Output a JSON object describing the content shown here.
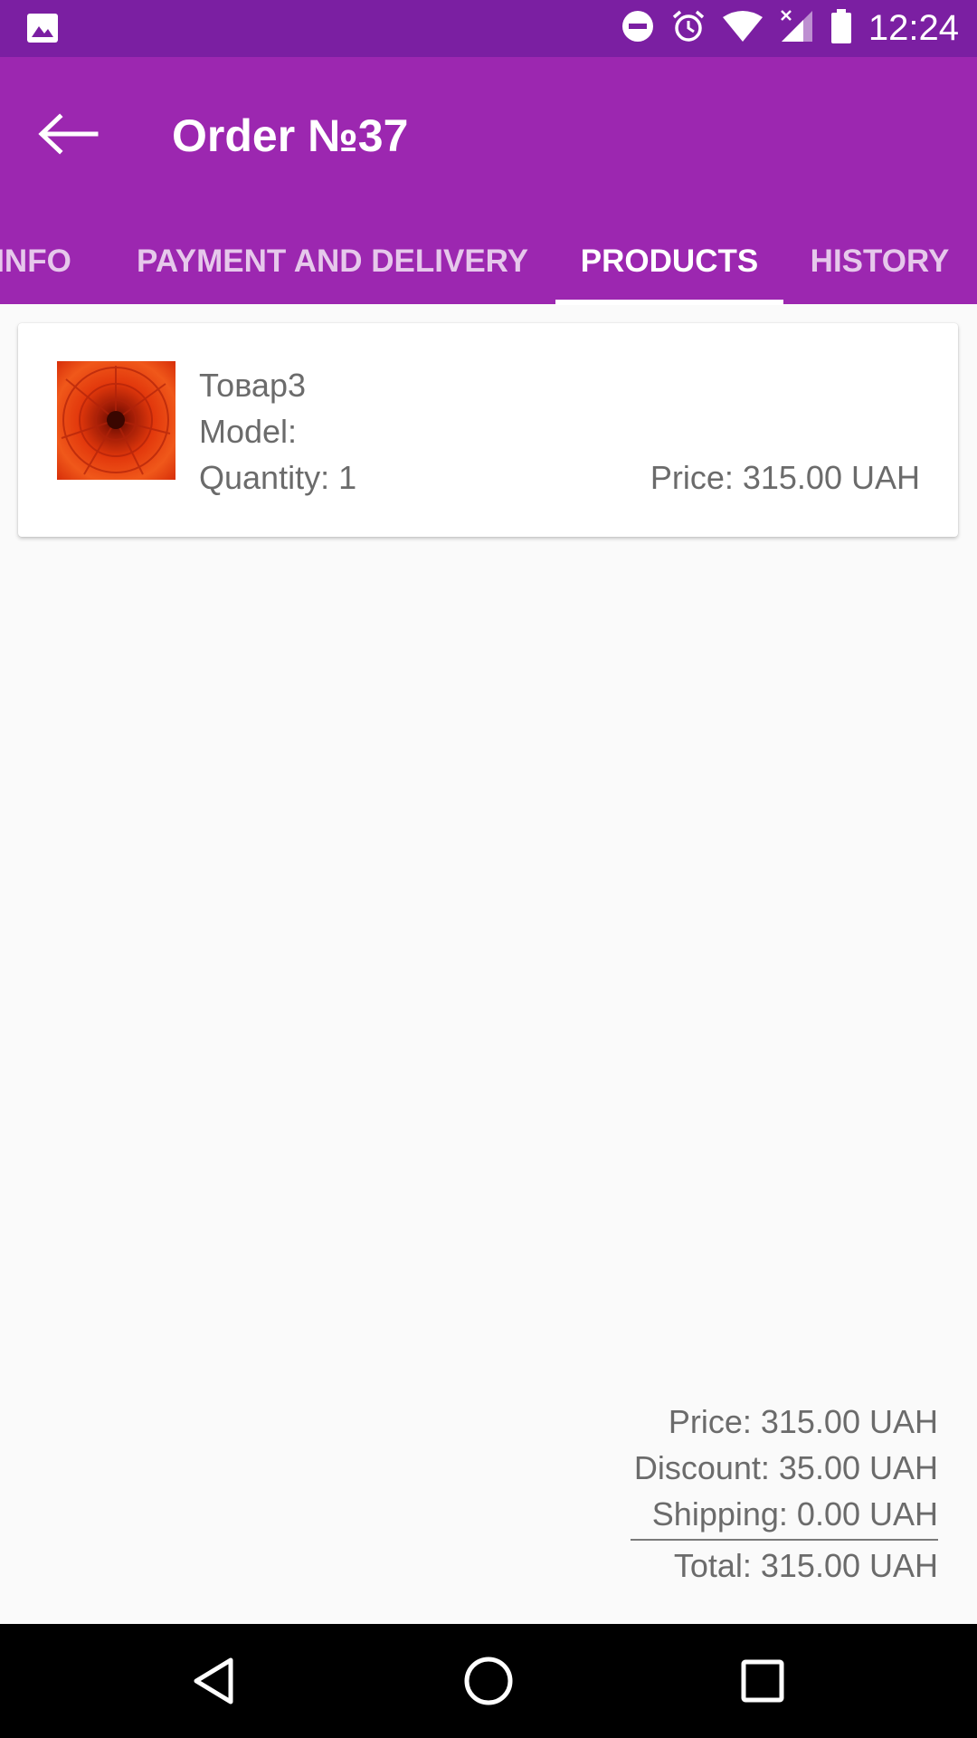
{
  "status_bar": {
    "time": "12:24",
    "icons": [
      "image-icon",
      "dnd-icon",
      "alarm-icon",
      "wifi-icon",
      "signal-icon",
      "battery-icon"
    ]
  },
  "app_bar": {
    "title": "Order №37",
    "back_icon": "arrow-back-icon",
    "tabs": [
      {
        "label": "INFO",
        "active": false
      },
      {
        "label": "PAYMENT AND DELIVERY",
        "active": false
      },
      {
        "label": "PRODUCTS",
        "active": true
      },
      {
        "label": "HISTORY",
        "active": false
      }
    ]
  },
  "products": [
    {
      "name": "Товар3",
      "model": "Model:",
      "quantity": "Quantity: 1",
      "price": "Price: 315.00 UAH",
      "image_icon": "flower-image"
    }
  ],
  "summary": {
    "price": "Price: 315.00 UAH",
    "discount": "Discount: 35.00 UAH",
    "shipping": "Shipping: 0.00 UAH",
    "total": "Total: 315.00 UAH"
  },
  "nav_bar": {
    "back": "back-triangle-icon",
    "home": "home-circle-icon",
    "recents": "recents-square-icon"
  },
  "colors": {
    "status_bar": "#7b1fa2",
    "app_bar": "#9c27b0",
    "background": "#fafafa",
    "text_secondary": "#6b6b6b"
  }
}
